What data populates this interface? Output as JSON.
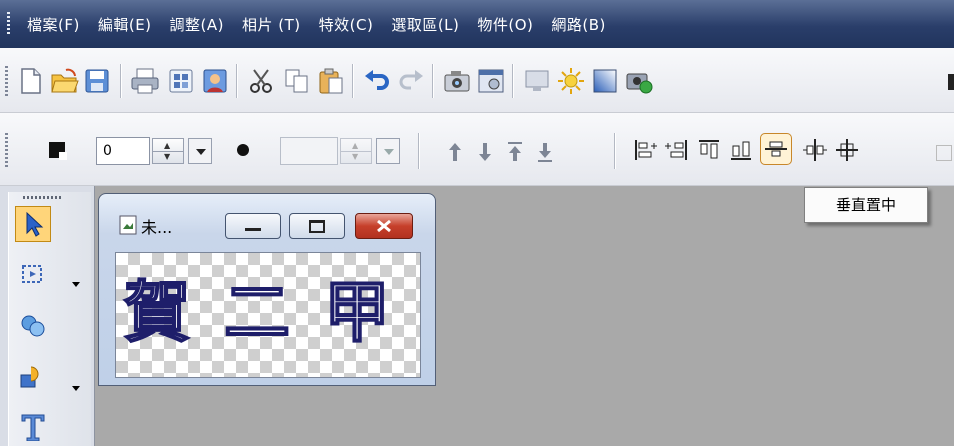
{
  "menu": {
    "items": [
      "檔案(F)",
      "編輯(E)",
      "調整(A)",
      "相片 (T)",
      "特效(C)",
      "選取區(L)",
      "物件(O)",
      "網路(B)"
    ]
  },
  "toolbar1": {
    "icons": [
      "new-icon",
      "open-icon",
      "save-icon",
      "print-icon",
      "scan-icon",
      "photo-icon",
      "cut-icon",
      "copy-icon",
      "paste-icon",
      "undo-icon",
      "redo-icon",
      "camera-icon",
      "capture-icon",
      "screen-icon",
      "brightness-icon",
      "gradient-icon",
      "sticker-icon"
    ]
  },
  "toolbar2": {
    "line_width_value": "0",
    "align_icons": [
      "move-up-icon",
      "move-down-icon",
      "bring-to-top-icon",
      "send-to-bottom-icon",
      "align-left-icon",
      "align-right-icon",
      "align-top-icon",
      "align-bottom-icon",
      "center-vertical-icon",
      "center-horizontal-icon",
      "center-both-icon"
    ]
  },
  "tooltip": {
    "text": "垂直置中"
  },
  "tools": {
    "icons": [
      "pointer-icon",
      "selection-icon",
      "shape-icon",
      "object-icon",
      "text-icon"
    ]
  },
  "document": {
    "title": "未...",
    "canvas_text": "賀二甲"
  },
  "colors": {
    "menubar": "#2a3e6a",
    "active_tool": "#ffd57a",
    "close_button": "#c6402b",
    "workspace": "#a9a9a9"
  }
}
